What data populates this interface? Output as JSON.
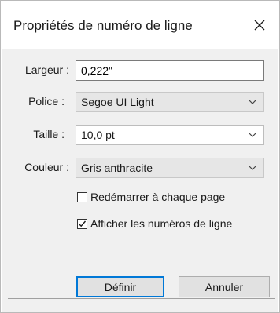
{
  "dialog": {
    "title": "Propriétés de numéro de ligne",
    "close_icon": "close-icon"
  },
  "fields": {
    "largeur": {
      "label": "Largeur :",
      "value": "0,222\""
    },
    "police": {
      "label": "Police :",
      "value": "Segoe UI Light"
    },
    "taille": {
      "label": "Taille :",
      "value": "10,0 pt"
    },
    "couleur": {
      "label": "Couleur :",
      "value": "Gris anthracite"
    }
  },
  "options": {
    "restart_each_page": {
      "label": "Redémarrer à chaque page",
      "checked": false
    },
    "show_line_numbers": {
      "label": "Afficher les numéros de ligne",
      "checked": true
    }
  },
  "buttons": {
    "define": "Définir",
    "cancel": "Annuler"
  },
  "icons": {
    "close": "close-icon",
    "dropdown": "chevron-down-icon",
    "check": "checkmark-icon"
  }
}
